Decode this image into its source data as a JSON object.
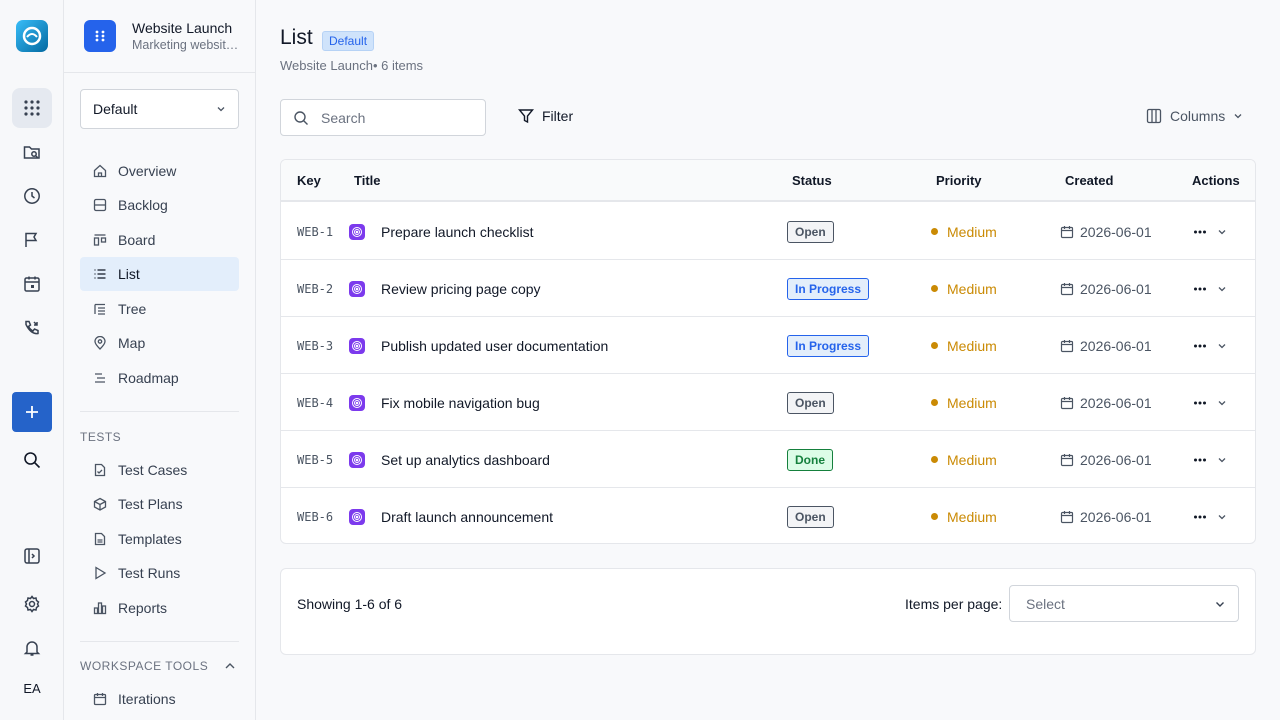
{
  "rail": {
    "items": [
      "apps-icon",
      "folder-search-icon",
      "clock-icon",
      "flag-icon",
      "calendar-icon",
      "phone-icon"
    ],
    "user_initials": "EA"
  },
  "project": {
    "name": "Website Launch",
    "description": "Marketing website launch"
  },
  "view_selector": {
    "value": "Default"
  },
  "nav": {
    "items": [
      {
        "label": "Overview",
        "icon": "home-icon"
      },
      {
        "label": "Backlog",
        "icon": "backlog-icon"
      },
      {
        "label": "Board",
        "icon": "board-icon"
      },
      {
        "label": "List",
        "icon": "list-icon",
        "active": true
      },
      {
        "label": "Tree",
        "icon": "tree-icon"
      },
      {
        "label": "Map",
        "icon": "map-pin-icon"
      },
      {
        "label": "Roadmap",
        "icon": "roadmap-icon"
      }
    ],
    "tests_header": "TESTS",
    "tests": [
      {
        "label": "Test Cases",
        "icon": "test-case-icon"
      },
      {
        "label": "Test Plans",
        "icon": "package-icon"
      },
      {
        "label": "Templates",
        "icon": "file-icon"
      },
      {
        "label": "Test Runs",
        "icon": "play-icon"
      },
      {
        "label": "Reports",
        "icon": "bar-chart-icon"
      }
    ],
    "workspace_header": "WORKSPACE TOOLS",
    "workspace": [
      {
        "label": "Iterations",
        "icon": "calendar-icon"
      }
    ]
  },
  "page": {
    "title": "List",
    "badge": "Default",
    "subtitle": "Website Launch• 6 items"
  },
  "toolbar": {
    "search_placeholder": "Search",
    "filter_label": "Filter",
    "columns_label": "Columns"
  },
  "table": {
    "columns": [
      "Key",
      "Title",
      "Status",
      "Priority",
      "Created",
      "Actions"
    ],
    "rows": [
      {
        "key": "WEB-1",
        "title": "Prepare launch checklist",
        "status": "Open",
        "status_kind": "open",
        "priority": "Medium",
        "created": "2026-06-01"
      },
      {
        "key": "WEB-2",
        "title": "Review pricing page copy",
        "status": "In Progress",
        "status_kind": "prog",
        "priority": "Medium",
        "created": "2026-06-01"
      },
      {
        "key": "WEB-3",
        "title": "Publish updated user documentation",
        "status": "In Progress",
        "status_kind": "prog",
        "priority": "Medium",
        "created": "2026-06-01"
      },
      {
        "key": "WEB-4",
        "title": "Fix mobile navigation bug",
        "status": "Open",
        "status_kind": "open",
        "priority": "Medium",
        "created": "2026-06-01"
      },
      {
        "key": "WEB-5",
        "title": "Set up analytics dashboard",
        "status": "Done",
        "status_kind": "done",
        "priority": "Medium",
        "created": "2026-06-01"
      },
      {
        "key": "WEB-6",
        "title": "Draft launch announcement",
        "status": "Open",
        "status_kind": "open",
        "priority": "Medium",
        "created": "2026-06-01"
      }
    ]
  },
  "pagination": {
    "showing": "Showing 1-6 of 6",
    "items_per_page_label": "Items per page:",
    "select_placeholder": "Select"
  },
  "colors": {
    "accent": "#2563eb",
    "priority_medium": "#ca8a04",
    "done": "#15803d"
  }
}
